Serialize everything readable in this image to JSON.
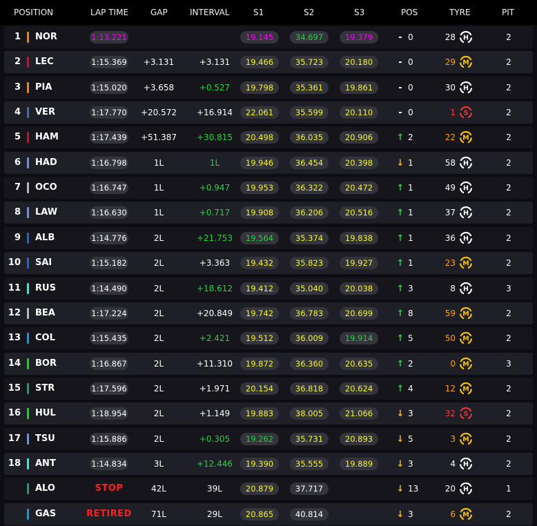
{
  "header": {
    "position": "POSITION",
    "lap_time": "LAP TIME",
    "gap": "GAP",
    "interval": "INTERVAL",
    "s1": "S1",
    "s2": "S2",
    "s3": "S3",
    "pos": "POS",
    "tyre": "TYRE",
    "pit": "PIT"
  },
  "colors": {
    "purple": "#ff00ff",
    "green": "#22d639",
    "yellow": "#f5f52a",
    "white": "#ffffff",
    "red": "#ff1e1e",
    "tyre_age_orange": "#ffa20d",
    "tyre_age_red": "#ff3b3b",
    "arrow_up": "#22d639",
    "arrow_down": "#ffb300"
  },
  "rows": [
    {
      "pos": "1",
      "bar": "#ff8000",
      "driver": "NOR",
      "lap": "1:13.221",
      "lap_c": "purple",
      "gap": "",
      "interval": "",
      "int_c": "white",
      "s1": "19.145",
      "s1_c": "purple",
      "s2": "34.697",
      "s2_c": "green",
      "s3": "19.379",
      "s3_c": "purple",
      "pos_change": "0",
      "arrow": "-",
      "age": "28",
      "age_c": "white",
      "tyre": "H",
      "pit": "2"
    },
    {
      "pos": "2",
      "bar": "#e8002d",
      "driver": "LEC",
      "lap": "1:15.369",
      "lap_c": "white",
      "gap": "+3.131",
      "interval": "+3.131",
      "int_c": "white",
      "s1": "19.466",
      "s1_c": "yellow",
      "s2": "35.723",
      "s2_c": "yellow",
      "s3": "20.180",
      "s3_c": "yellow",
      "pos_change": "0",
      "arrow": "-",
      "age": "29",
      "age_c": "orange",
      "tyre": "M",
      "pit": "2"
    },
    {
      "pos": "3",
      "bar": "#ff8000",
      "driver": "PIA",
      "lap": "1:15.020",
      "lap_c": "white",
      "gap": "+3.658",
      "interval": "+0.527",
      "int_c": "green",
      "s1": "19.798",
      "s1_c": "yellow",
      "s2": "35.361",
      "s2_c": "yellow",
      "s3": "19.861",
      "s3_c": "yellow",
      "pos_change": "0",
      "arrow": "-",
      "age": "30",
      "age_c": "white",
      "tyre": "H",
      "pit": "2"
    },
    {
      "pos": "4",
      "bar": "#3671c6",
      "driver": "VER",
      "lap": "1:17.770",
      "lap_c": "white",
      "gap": "+20.572",
      "interval": "+16.914",
      "int_c": "white",
      "s1": "22.061",
      "s1_c": "yellow",
      "s2": "35.599",
      "s2_c": "yellow",
      "s3": "20.110",
      "s3_c": "yellow",
      "pos_change": "0",
      "arrow": "-",
      "age": "1",
      "age_c": "red",
      "tyre": "S",
      "pit": "2"
    },
    {
      "pos": "5",
      "bar": "#e8002d",
      "driver": "HAM",
      "lap": "1:17.439",
      "lap_c": "white",
      "gap": "+51.387",
      "interval": "+30.815",
      "int_c": "green",
      "s1": "20.498",
      "s1_c": "yellow",
      "s2": "36.035",
      "s2_c": "yellow",
      "s3": "20.906",
      "s3_c": "yellow",
      "pos_change": "2",
      "arrow": "up",
      "age": "22",
      "age_c": "orange",
      "tyre": "M",
      "pit": "2"
    },
    {
      "pos": "6",
      "bar": "#6692ff",
      "driver": "HAD",
      "lap": "1:16.798",
      "lap_c": "white",
      "gap": "1L",
      "interval": "1L",
      "int_c": "green",
      "s1": "19.946",
      "s1_c": "yellow",
      "s2": "36.454",
      "s2_c": "yellow",
      "s3": "20.398",
      "s3_c": "yellow",
      "pos_change": "1",
      "arrow": "down",
      "age": "58",
      "age_c": "white",
      "tyre": "H",
      "pit": "2"
    },
    {
      "pos": "7",
      "bar": "#b6babd",
      "driver": "OCO",
      "lap": "1:16.747",
      "lap_c": "white",
      "gap": "1L",
      "interval": "+0.947",
      "int_c": "green",
      "s1": "19.953",
      "s1_c": "yellow",
      "s2": "36.322",
      "s2_c": "yellow",
      "s3": "20.472",
      "s3_c": "yellow",
      "pos_change": "1",
      "arrow": "up",
      "age": "49",
      "age_c": "white",
      "tyre": "H",
      "pit": "2"
    },
    {
      "pos": "8",
      "bar": "#6692ff",
      "driver": "LAW",
      "lap": "1:16.630",
      "lap_c": "white",
      "gap": "1L",
      "interval": "+0.717",
      "int_c": "green",
      "s1": "19.908",
      "s1_c": "yellow",
      "s2": "36.206",
      "s2_c": "yellow",
      "s3": "20.516",
      "s3_c": "yellow",
      "pos_change": "1",
      "arrow": "up",
      "age": "37",
      "age_c": "white",
      "tyre": "H",
      "pit": "2"
    },
    {
      "pos": "9",
      "bar": "#1868db",
      "driver": "ALB",
      "lap": "1:14.776",
      "lap_c": "white",
      "gap": "2L",
      "interval": "+21.753",
      "int_c": "green",
      "s1": "19.564",
      "s1_c": "green",
      "s2": "35.374",
      "s2_c": "yellow",
      "s3": "19.838",
      "s3_c": "yellow",
      "pos_change": "1",
      "arrow": "up",
      "age": "36",
      "age_c": "white",
      "tyre": "H",
      "pit": "2"
    },
    {
      "pos": "10",
      "bar": "#1868db",
      "driver": "SAI",
      "lap": "1:15.182",
      "lap_c": "white",
      "gap": "2L",
      "interval": "+3.363",
      "int_c": "white",
      "s1": "19.432",
      "s1_c": "yellow",
      "s2": "35.823",
      "s2_c": "yellow",
      "s3": "19.927",
      "s3_c": "yellow",
      "pos_change": "1",
      "arrow": "up",
      "age": "23",
      "age_c": "orange",
      "tyre": "M",
      "pit": "2"
    },
    {
      "pos": "11",
      "bar": "#27f4d2",
      "driver": "RUS",
      "lap": "1:14.490",
      "lap_c": "white",
      "gap": "2L",
      "interval": "+18.612",
      "int_c": "green",
      "s1": "19.412",
      "s1_c": "yellow",
      "s2": "35.040",
      "s2_c": "yellow",
      "s3": "20.038",
      "s3_c": "yellow",
      "pos_change": "3",
      "arrow": "up",
      "age": "8",
      "age_c": "white",
      "tyre": "H",
      "pit": "3"
    },
    {
      "pos": "12",
      "bar": "#b6babd",
      "driver": "BEA",
      "lap": "1:17.224",
      "lap_c": "white",
      "gap": "2L",
      "interval": "+20.849",
      "int_c": "white",
      "s1": "19.742",
      "s1_c": "yellow",
      "s2": "36.783",
      "s2_c": "yellow",
      "s3": "20.699",
      "s3_c": "yellow",
      "pos_change": "8",
      "arrow": "up",
      "age": "59",
      "age_c": "orange",
      "tyre": "M",
      "pit": "2"
    },
    {
      "pos": "13",
      "bar": "#00a1e8",
      "driver": "COL",
      "lap": "1:15.435",
      "lap_c": "white",
      "gap": "2L",
      "interval": "+2.421",
      "int_c": "green",
      "s1": "19.512",
      "s1_c": "yellow",
      "s2": "36.009",
      "s2_c": "yellow",
      "s3": "19.914",
      "s3_c": "green",
      "pos_change": "5",
      "arrow": "up",
      "age": "50",
      "age_c": "orange",
      "tyre": "M",
      "pit": "2"
    },
    {
      "pos": "14",
      "bar": "#00e701",
      "driver": "BOR",
      "lap": "1:16.867",
      "lap_c": "white",
      "gap": "2L",
      "interval": "+11.310",
      "int_c": "white",
      "s1": "19.872",
      "s1_c": "yellow",
      "s2": "36.360",
      "s2_c": "yellow",
      "s3": "20.635",
      "s3_c": "yellow",
      "pos_change": "2",
      "arrow": "up",
      "age": "0",
      "age_c": "orange",
      "tyre": "M",
      "pit": "3"
    },
    {
      "pos": "15",
      "bar": "#229971",
      "driver": "STR",
      "lap": "1:17.596",
      "lap_c": "white",
      "gap": "2L",
      "interval": "+1.971",
      "int_c": "white",
      "s1": "20.154",
      "s1_c": "yellow",
      "s2": "36.818",
      "s2_c": "yellow",
      "s3": "20.624",
      "s3_c": "yellow",
      "pos_change": "4",
      "arrow": "up",
      "age": "12",
      "age_c": "orange",
      "tyre": "M",
      "pit": "2"
    },
    {
      "pos": "16",
      "bar": "#00e701",
      "driver": "HUL",
      "lap": "1:18.954",
      "lap_c": "white",
      "gap": "2L",
      "interval": "+1.149",
      "int_c": "white",
      "s1": "19.883",
      "s1_c": "yellow",
      "s2": "38.005",
      "s2_c": "yellow",
      "s3": "21.066",
      "s3_c": "yellow",
      "pos_change": "3",
      "arrow": "down",
      "age": "32",
      "age_c": "red",
      "tyre": "S",
      "pit": "2"
    },
    {
      "pos": "17",
      "bar": "#6692ff",
      "driver": "TSU",
      "lap": "1:15.886",
      "lap_c": "white",
      "gap": "2L",
      "interval": "+0.305",
      "int_c": "green",
      "s1": "19.262",
      "s1_c": "green",
      "s2": "35.731",
      "s2_c": "yellow",
      "s3": "20.893",
      "s3_c": "yellow",
      "pos_change": "5",
      "arrow": "down",
      "age": "3",
      "age_c": "orange",
      "tyre": "M",
      "pit": "2"
    },
    {
      "pos": "18",
      "bar": "#27f4d2",
      "driver": "ANT",
      "lap": "1:14.834",
      "lap_c": "white",
      "gap": "3L",
      "interval": "+12.446",
      "int_c": "green",
      "s1": "19.390",
      "s1_c": "yellow",
      "s2": "35.555",
      "s2_c": "yellow",
      "s3": "19.889",
      "s3_c": "yellow",
      "pos_change": "3",
      "arrow": "down",
      "age": "4",
      "age_c": "white",
      "tyre": "H",
      "pit": "2"
    },
    {
      "pos": "",
      "bar": "#229971",
      "driver": "ALO",
      "lap": "STOP",
      "lap_c": "red",
      "gap": "42L",
      "interval": "39L",
      "int_c": "white",
      "s1": "20.879",
      "s1_c": "yellow",
      "s2": "37.717",
      "s2_c": "white",
      "s3": "",
      "s3_c": "white",
      "pos_change": "13",
      "arrow": "down",
      "age": "20",
      "age_c": "white",
      "tyre": "H",
      "pit": "1"
    },
    {
      "pos": "",
      "bar": "#00a1e8",
      "driver": "GAS",
      "lap": "RETIRED",
      "lap_c": "red",
      "gap": "71L",
      "interval": "29L",
      "int_c": "white",
      "s1": "20.865",
      "s1_c": "yellow",
      "s2": "40.814",
      "s2_c": "white",
      "s3": "",
      "s3_c": "white",
      "pos_change": "3",
      "arrow": "down",
      "age": "6",
      "age_c": "orange",
      "tyre": "M",
      "pit": "2"
    }
  ]
}
